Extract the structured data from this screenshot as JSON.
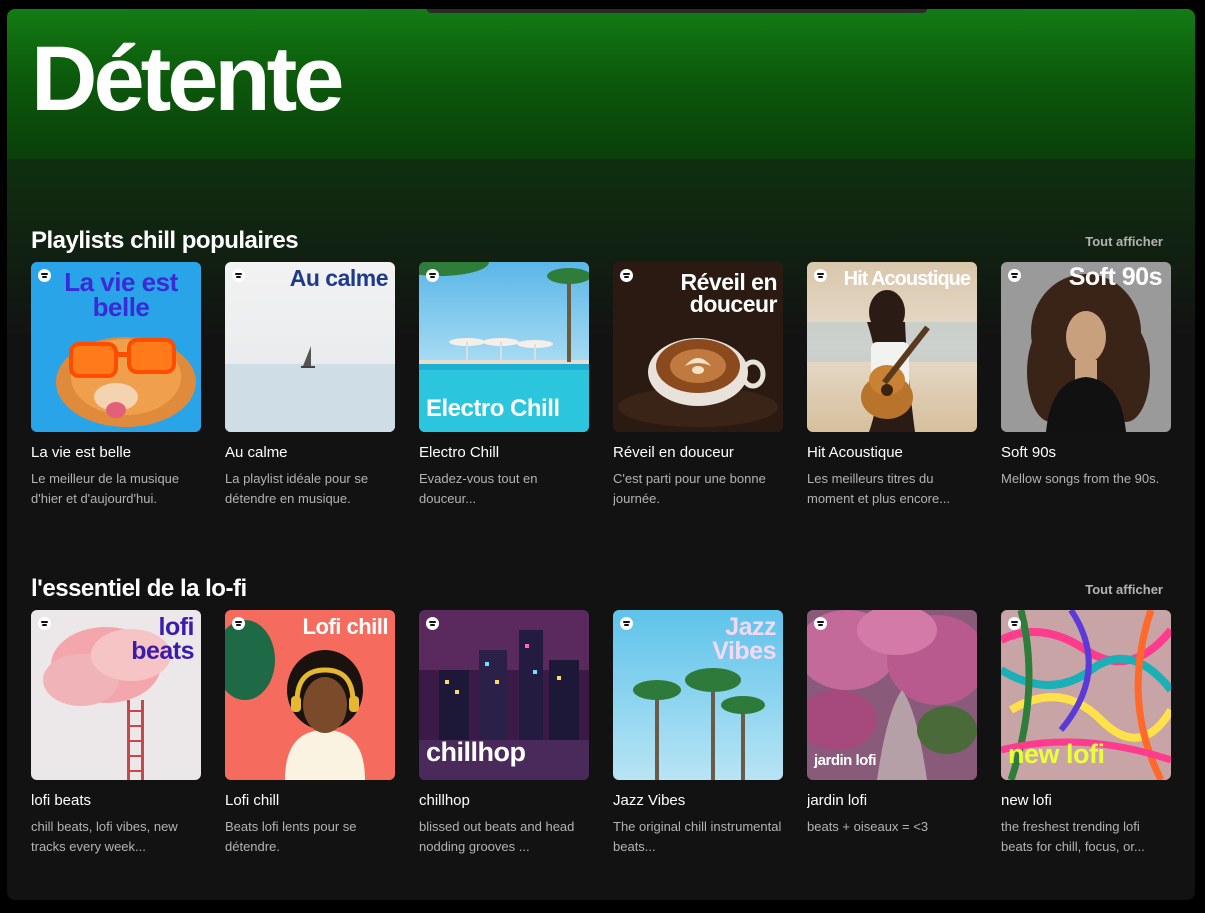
{
  "page": {
    "title": "Détente",
    "accent_color": "#137c13"
  },
  "sections": [
    {
      "title": "Playlists chill populaires",
      "show_all": "Tout afficher",
      "cards": [
        {
          "title": "La vie est belle",
          "description": "Le meilleur de la musique d'hier et d'aujourd'hui.",
          "cover_text": "La vie est belle"
        },
        {
          "title": "Au calme",
          "description": "La playlist idéale pour se détendre en musique.",
          "cover_text": "Au calme"
        },
        {
          "title": "Electro Chill",
          "description": "Evadez-vous tout en douceur...",
          "cover_text": "Electro Chill"
        },
        {
          "title": "Réveil en douceur",
          "description": "C'est parti pour une bonne journée.",
          "cover_text": "Réveil en douceur"
        },
        {
          "title": "Hit Acoustique",
          "description": "Les meilleurs titres du moment et plus encore...",
          "cover_text": "Hit Acoustique"
        },
        {
          "title": "Soft 90s",
          "description": "Mellow songs from the 90s.",
          "cover_text": "Soft 90s"
        }
      ]
    },
    {
      "title": "l'essentiel de la lo-fi",
      "show_all": "Tout afficher",
      "cards": [
        {
          "title": "lofi beats",
          "description": "chill beats, lofi vibes, new tracks every week...",
          "cover_text": "lofi beats"
        },
        {
          "title": "Lofi chill",
          "description": "Beats lofi lents pour se détendre.",
          "cover_text": "Lofi chill"
        },
        {
          "title": "chillhop",
          "description": "blissed out beats and head nodding grooves ...",
          "cover_text": "chillhop"
        },
        {
          "title": "Jazz Vibes",
          "description": "The original chill instrumental beats...",
          "cover_text": "Jazz Vibes"
        },
        {
          "title": "jardin lofi",
          "description": "beats + oiseaux = <3",
          "cover_text": "jardin lofi"
        },
        {
          "title": "new lofi",
          "description": "the freshest trending lofi beats for chill, focus, or...",
          "cover_text": "new lofi"
        }
      ]
    }
  ],
  "icons": {
    "cover_badge": "spotify-logo-icon"
  }
}
